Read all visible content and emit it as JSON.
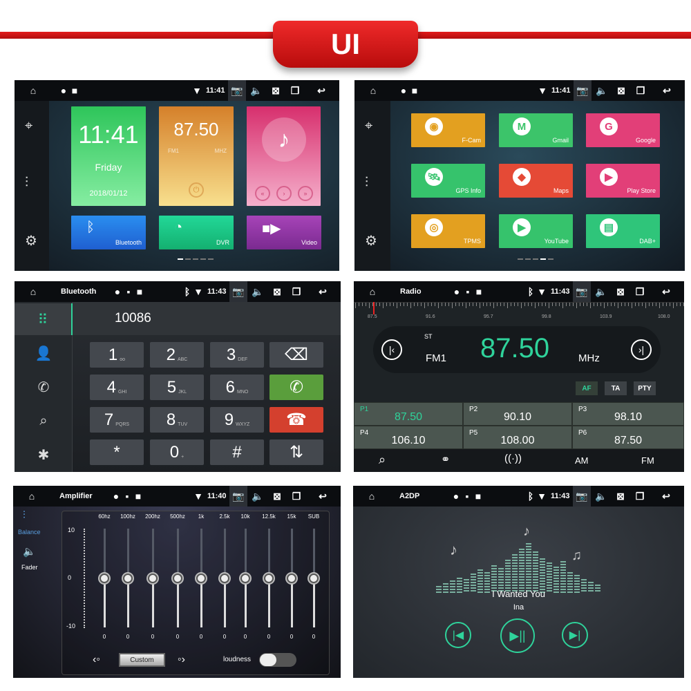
{
  "banner": {
    "label": "UI"
  },
  "colors": {
    "accent_green": "#2fd39b",
    "brand_red": "#d61414",
    "call_green": "#5a9e3c",
    "end_red": "#d4402e"
  },
  "home": {
    "status": {
      "time": "11:41",
      "bt": false
    },
    "clock": {
      "time": "11:41",
      "day": "Friday",
      "date": "2018/01/12"
    },
    "radio": {
      "freq": "87.50",
      "band": "FM1",
      "unit": "MHZ"
    },
    "tiles": [
      {
        "label": "Bluetooth",
        "icon": "bluetooth-icon"
      },
      {
        "label": "DVR",
        "icon": "speedometer-icon"
      },
      {
        "label": "Video",
        "icon": "video-camera-icon"
      }
    ],
    "page": 1,
    "pages": 5,
    "sidebar": [
      "location-pin-icon",
      "equalizer-icon",
      "gear-icon"
    ]
  },
  "apps": {
    "status": {
      "time": "11:41",
      "bt": false
    },
    "page": 4,
    "pages": 5,
    "items": [
      {
        "label": "F-Cam",
        "color": "#e3a020",
        "icon": "camera-icon"
      },
      {
        "label": "Gmail",
        "color": "#3cc46a",
        "icon": "gmail-icon"
      },
      {
        "label": "Google",
        "color": "#e23f78",
        "icon": "google-icon"
      },
      {
        "label": "GPS Info",
        "color": "#36c36c",
        "icon": "satellite-icon"
      },
      {
        "label": "Maps",
        "color": "#e54a36",
        "icon": "maps-icon"
      },
      {
        "label": "Play Store",
        "color": "#e23f78",
        "icon": "play-store-icon"
      },
      {
        "label": "TPMS",
        "color": "#e3a020",
        "icon": "tire-icon"
      },
      {
        "label": "YouTube",
        "color": "#36c36c",
        "icon": "youtube-icon"
      },
      {
        "label": "DAB+",
        "color": "#2fc57a",
        "icon": "radio-icon"
      }
    ]
  },
  "bluetooth": {
    "status": {
      "title": "Bluetooth",
      "time": "11:43",
      "bt": true
    },
    "number": "10086",
    "keys": [
      [
        "1",
        "oo"
      ],
      [
        "2",
        "ABC"
      ],
      [
        "3",
        "DEF"
      ],
      [
        "⌫",
        ""
      ],
      [
        "4",
        "GHI"
      ],
      [
        "5",
        "JKL"
      ],
      [
        "6",
        "MNO"
      ],
      [
        "✆",
        ""
      ],
      [
        "7",
        "PQRS"
      ],
      [
        "8",
        "TUV"
      ],
      [
        "9",
        "WXYZ"
      ],
      [
        "☎",
        ""
      ],
      [
        "*",
        ""
      ],
      [
        "0",
        "+"
      ],
      [
        "#",
        ""
      ],
      [
        "⇅",
        ""
      ]
    ],
    "sidebar": [
      "dialpad-icon",
      "contact-icon",
      "call-log-icon",
      "search-icon",
      "bluetooth-settings-icon"
    ]
  },
  "radio": {
    "status": {
      "title": "Radio",
      "time": "11:43",
      "bt": true
    },
    "scale": [
      "87.5",
      "91.6",
      "95.7",
      "99.8",
      "103.9",
      "108.0"
    ],
    "stereo": "ST",
    "band": "FM1",
    "freq": "87.50",
    "unit": "MHz",
    "buttons": [
      "AF",
      "TA",
      "PTY"
    ],
    "presets": [
      {
        "n": "P1",
        "v": "87.50"
      },
      {
        "n": "P2",
        "v": "90.10"
      },
      {
        "n": "P3",
        "v": "98.10"
      },
      {
        "n": "P4",
        "v": "106.10"
      },
      {
        "n": "P5",
        "v": "108.00"
      },
      {
        "n": "P6",
        "v": "87.50"
      }
    ],
    "bottom": {
      "am": "AM",
      "fm": "FM"
    }
  },
  "amp": {
    "status": {
      "title": "Amplifier",
      "time": "11:40",
      "bt": false
    },
    "side": {
      "balance": "Balance",
      "fader": "Fader"
    },
    "scale": {
      "max": "10",
      "mid": "0",
      "min": "-10"
    },
    "bands": [
      {
        "l": "60hz",
        "v": "0"
      },
      {
        "l": "100hz",
        "v": "0"
      },
      {
        "l": "200hz",
        "v": "0"
      },
      {
        "l": "500hz",
        "v": "0"
      },
      {
        "l": "1k",
        "v": "0"
      },
      {
        "l": "2.5k",
        "v": "0"
      },
      {
        "l": "10k",
        "v": "0"
      },
      {
        "l": "12.5k",
        "v": "0"
      },
      {
        "l": "15k",
        "v": "0"
      },
      {
        "l": "SUB",
        "v": "0"
      }
    ],
    "preset": "Custom",
    "loudness": "loudness",
    "loudness_on": false
  },
  "a2dp": {
    "status": {
      "title": "A2DP",
      "time": "11:43",
      "bt": true
    },
    "song": "I Wanted You",
    "artist": "Ina"
  }
}
